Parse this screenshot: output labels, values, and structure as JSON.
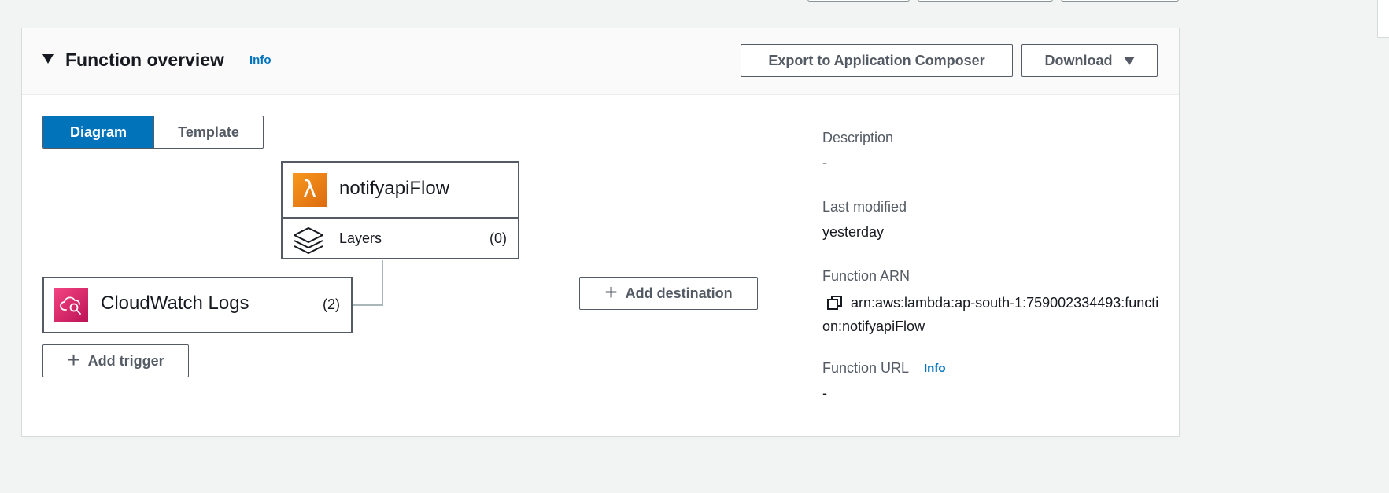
{
  "overview": {
    "title": "Function overview",
    "info": "Info",
    "export_button": "Export to Application Composer",
    "download_button": "Download"
  },
  "tabs": [
    {
      "label": "Diagram",
      "selected": true
    },
    {
      "label": "Template",
      "selected": false
    }
  ],
  "diagram": {
    "function_name": "notifyapiFlow",
    "layers_label": "Layers",
    "layers_count": "(0)",
    "trigger_name": "CloudWatch Logs",
    "trigger_count": "(2)",
    "add_trigger": "Add trigger",
    "add_destination": "Add destination"
  },
  "details": {
    "description_label": "Description",
    "description_value": "-",
    "last_modified_label": "Last modified",
    "last_modified_value": "yesterday",
    "arn_label": "Function ARN",
    "arn_value": "arn:aws:lambda:ap-south-1:759002334493:function:notifyapiFlow",
    "url_label": "Function URL",
    "url_info": "Info",
    "url_value": "-"
  },
  "colors": {
    "accent": "#0073bb",
    "lambda_orange": "#ed7100",
    "cloudwatch_pink": "#e7157b"
  },
  "icons": {
    "collapse": "caret-down-icon",
    "dropdown": "caret-down-icon",
    "lambda": "lambda-icon",
    "layers": "layers-icon",
    "cloudwatch": "cloudwatch-logs-icon",
    "add": "plus-icon",
    "copy": "copy-icon"
  }
}
